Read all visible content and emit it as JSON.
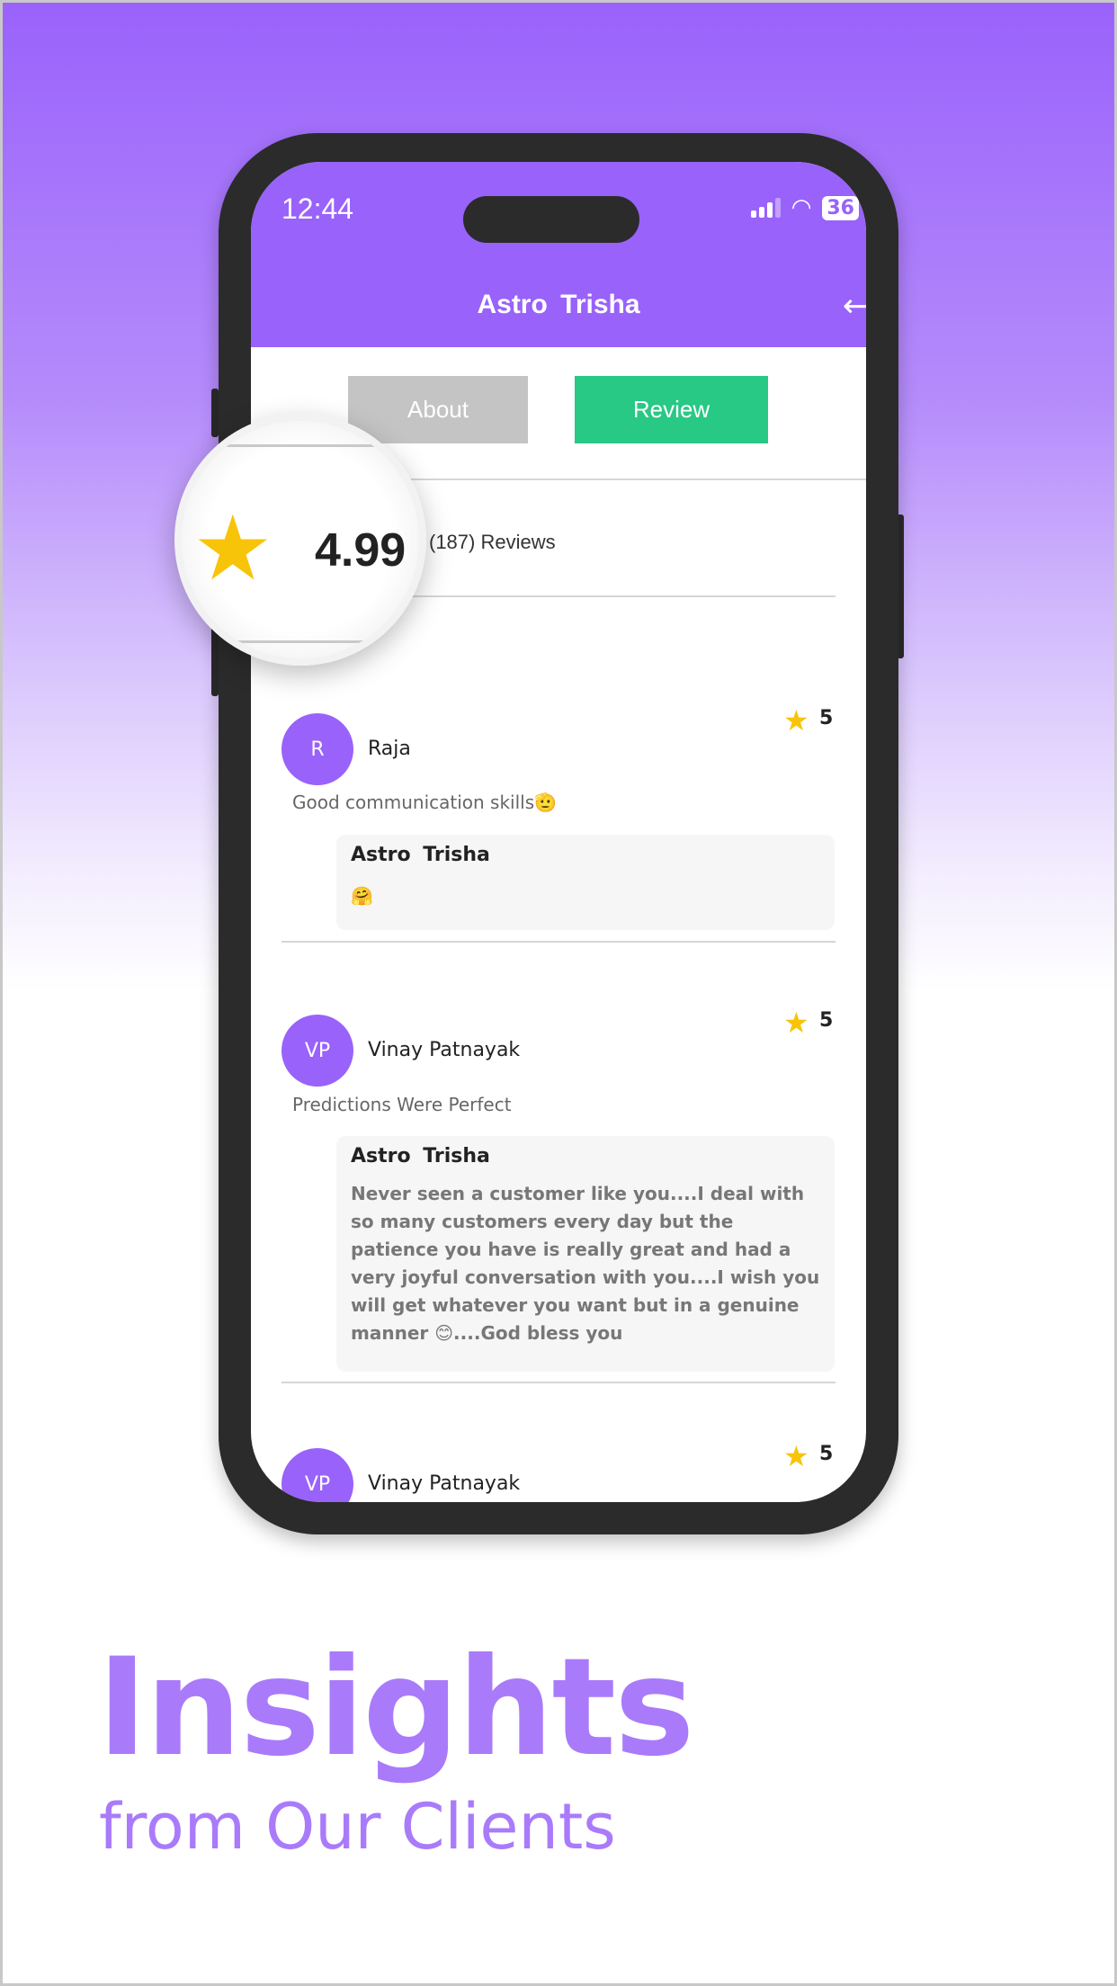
{
  "status_bar": {
    "time": "12:44",
    "battery": "36"
  },
  "header": {
    "title": "Astro  Trisha",
    "back_icon": "back-arrow-icon"
  },
  "tabs": [
    {
      "label": "About",
      "color": "#c4c4c4"
    },
    {
      "label": "Review",
      "color": "#28c885",
      "active": true
    }
  ],
  "rating": {
    "value": "4.99",
    "count_label": "(187) Reviews"
  },
  "reviews": [
    {
      "initials": "R",
      "name": "Raja",
      "stars": "5",
      "comment": "Good communication skills🫡",
      "reply": {
        "name": "Astro  Trisha",
        "text": "🤗"
      }
    },
    {
      "initials": "VP",
      "name": "Vinay Patnayak",
      "stars": "5",
      "comment": "Predictions Were Perfect",
      "reply": {
        "name": "Astro  Trisha",
        "text": "Never seen a customer like you....I deal with so many customers every day but the patience you have is really great and had a very joyful conversation with you....I wish you will get whatever you want but in a genuine manner 😊....God bless you"
      }
    },
    {
      "initials": "VP",
      "name": "Vinay Patnayak",
      "stars": "5"
    }
  ],
  "headline": {
    "title": "Insights",
    "subtitle": "from Our Clients"
  },
  "colors": {
    "brand": "#9962fa",
    "accent": "#28c885",
    "star": "#f8c40a",
    "headline": "#a97bfa"
  }
}
